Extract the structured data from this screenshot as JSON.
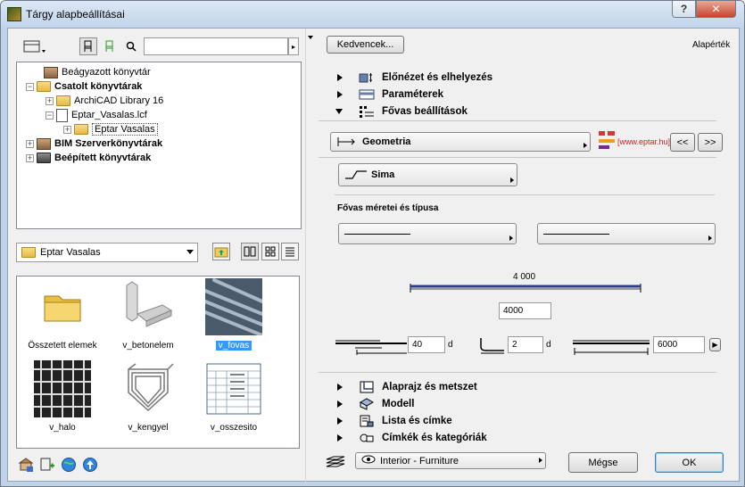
{
  "window": {
    "title": "Tárgy alapbeállításai",
    "help_label": "?",
    "close_label": "✕"
  },
  "left": {
    "tree": {
      "items": [
        {
          "label": "Beágyazott könyvtár",
          "bold": false
        },
        {
          "label": "Csatolt könyvtárak",
          "bold": true
        },
        {
          "label": "ArchiCAD Library 16",
          "bold": false
        },
        {
          "label": "Eptar_Vasalas.lcf",
          "bold": false
        },
        {
          "label": "Eptar Vasalas",
          "bold": false
        },
        {
          "label": "BIM Szerverkönyvtárak",
          "bold": true
        },
        {
          "label": "Beépített könyvtárak",
          "bold": true
        }
      ]
    },
    "folder_select": {
      "value": "Eptar Vasalas"
    },
    "thumbnails": [
      {
        "label": "Összetett elemek",
        "selected": false
      },
      {
        "label": "v_betonelem",
        "selected": false
      },
      {
        "label": "v_fovas",
        "selected": true
      },
      {
        "label": "v_halo",
        "selected": false
      },
      {
        "label": "v_kengyel",
        "selected": false
      },
      {
        "label": "v_osszesito",
        "selected": false
      }
    ]
  },
  "right": {
    "favorites_label": "Kedvencek...",
    "defaults_label": "Alapérték",
    "sections_top": [
      {
        "label": "Előnézet és elhelyezés",
        "expanded": false
      },
      {
        "label": "Paraméterek",
        "expanded": false
      },
      {
        "label": "Fővas beállítások",
        "expanded": true
      }
    ],
    "geometry_label": "Geometria",
    "logo_url_text": "[www.eptar.hu]",
    "prev_label": "<<",
    "next_label": ">>",
    "shape_label": "Sima",
    "size_type_label": "Fővas méretei és típusa",
    "dimension_value": "4 000",
    "length_field": "4000",
    "field_a": "40",
    "field_b": "2",
    "field_c": "6000",
    "unit_d": "d",
    "sections_bottom": [
      {
        "label": "Alaprajz és metszet"
      },
      {
        "label": "Modell"
      },
      {
        "label": "Lista és címke"
      },
      {
        "label": "Címkék és kategóriák"
      }
    ],
    "layer_label": "Interior - Furniture",
    "cancel_label": "Mégse",
    "ok_label": "OK"
  }
}
